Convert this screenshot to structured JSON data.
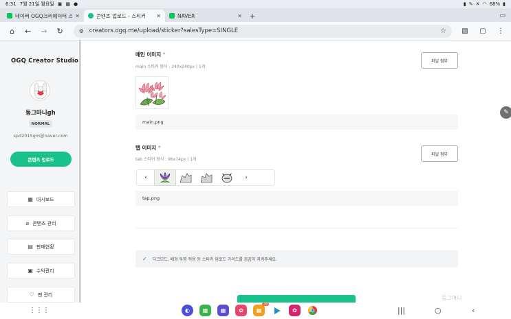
{
  "status_bar": {
    "time": "6:31",
    "date": "7월 21일 월요일",
    "battery": "68%",
    "left_icons": [
      "gallery-icon",
      "calendar-icon",
      "chat-icon"
    ],
    "right_icons": [
      "lock-icon",
      "pen-icon",
      "mute-icon",
      "wifi-icon",
      "battery-icon"
    ]
  },
  "tabs": [
    {
      "label": "네이버 OGQ크리에이터 스튜디오",
      "favicon_color": "#03c75a",
      "active": false
    },
    {
      "label": "콘텐츠 업로드 - 스티커",
      "favicon_color": "#19c28a",
      "active": true
    },
    {
      "label": "NAVER",
      "favicon_color": "#03c75a",
      "active": false
    }
  ],
  "urlbar": {
    "url": "creators.ogq.me/upload/sticker?salesType=SINGLE"
  },
  "sidebar": {
    "brand": "OGQ Creator Studio",
    "username": "동그마니gh",
    "grade": "NORMAL",
    "email": "spd2015gm@naver.com",
    "upload_button": "콘텐츠 업로드",
    "menu": [
      {
        "label": "대시보드",
        "icon": "dashboard-icon",
        "glyph": "▦"
      },
      {
        "label": "콘텐츠 관리",
        "icon": "clip-icon",
        "glyph": "⌀"
      },
      {
        "label": "판매현황",
        "icon": "list-icon",
        "glyph": "▤"
      },
      {
        "label": "수익관리",
        "icon": "wallet-icon",
        "glyph": "▣"
      },
      {
        "label": "팬 관리",
        "icon": "heart-icon",
        "glyph": "♡"
      }
    ]
  },
  "main": {
    "main_image": {
      "title": "메인 이미지",
      "required_mark": "*",
      "desc": "main 스티커 형식 : 240x240px | 1개",
      "attach_button": "파일 첨부",
      "filename": "main.png"
    },
    "tab_image": {
      "title": "탭 이미지",
      "required_mark": "*",
      "desc": "tab 스티커 형식 : 96x74px | 1개",
      "attach_button": "파일 첨부",
      "filename": "tap.png",
      "prev": "‹",
      "next": "›"
    },
    "notice": "다크모드, 배경 투명 적용 등 스티커 업로드 가이드를 꼼꼼히 지켜주세요."
  },
  "navbar": {
    "apps": [
      {
        "icon": "internet-icon",
        "color": "#4a4ed8"
      },
      {
        "icon": "apps-folder-icon",
        "color": "#3cb34a"
      },
      {
        "icon": "tools-folder-icon",
        "color": "#5a4fd0"
      },
      {
        "icon": "gallery-app-icon",
        "color": "#e8456a"
      },
      {
        "icon": "samsung-folder-icon",
        "color": "#f0a020",
        "badge": "38"
      },
      {
        "icon": "play-store-icon",
        "color": "#ffffff"
      },
      {
        "icon": "flower-app-icon",
        "color": "#d6246e"
      },
      {
        "icon": "chrome-icon",
        "color": "#ffffff"
      }
    ]
  },
  "watermark": "등그마니"
}
